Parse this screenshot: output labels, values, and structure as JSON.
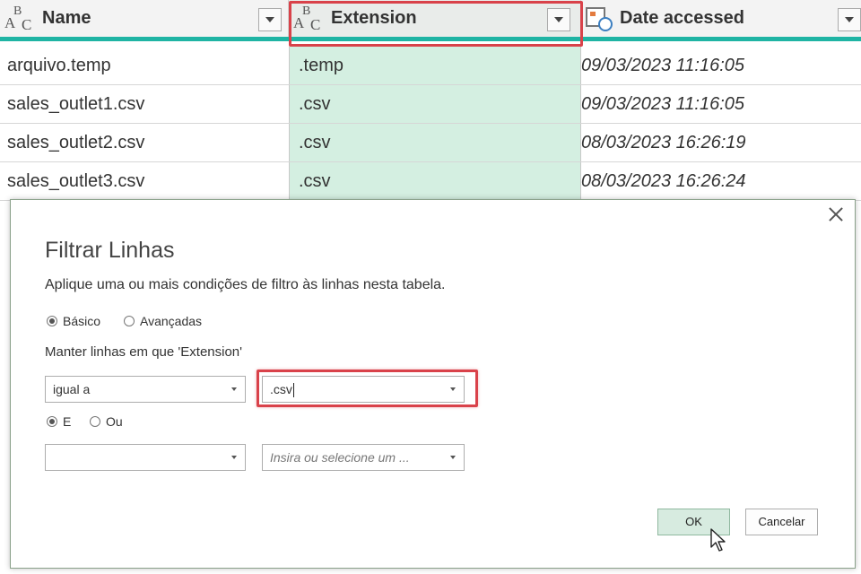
{
  "columns": [
    {
      "name": "Name",
      "type_icon": "text-type-icon"
    },
    {
      "name": "Extension",
      "type_icon": "text-type-icon"
    },
    {
      "name": "Date accessed",
      "type_icon": "datetime-type-icon"
    }
  ],
  "rows": [
    {
      "name": "arquivo.temp",
      "extension": ".temp",
      "date": "09/03/2023 11:16:05"
    },
    {
      "name": "sales_outlet1.csv",
      "extension": ".csv",
      "date": "09/03/2023 11:16:05"
    },
    {
      "name": "sales_outlet2.csv",
      "extension": ".csv",
      "date": "08/03/2023 16:26:19"
    },
    {
      "name": "sales_outlet3.csv",
      "extension": ".csv",
      "date": "08/03/2023 16:26:24"
    }
  ],
  "dialog": {
    "title": "Filtrar Linhas",
    "description": "Aplique uma ou mais condições de filtro às linhas nesta tabela.",
    "mode_basic": "Básico",
    "mode_advanced": "Avançadas",
    "mode_selected": "basic",
    "keep_label": "Manter linhas em que 'Extension'",
    "operator1": "igual a",
    "value1": ".csv",
    "logic_and": "E",
    "logic_or": "Ou",
    "operator2": "",
    "value2_placeholder": "Insira ou selecione um ...",
    "ok_label": "OK",
    "cancel_label": "Cancelar"
  },
  "colors": {
    "accent_teal": "#1fb4a4",
    "highlight_red": "#d9424a",
    "selected_column": "#d4efe1"
  }
}
